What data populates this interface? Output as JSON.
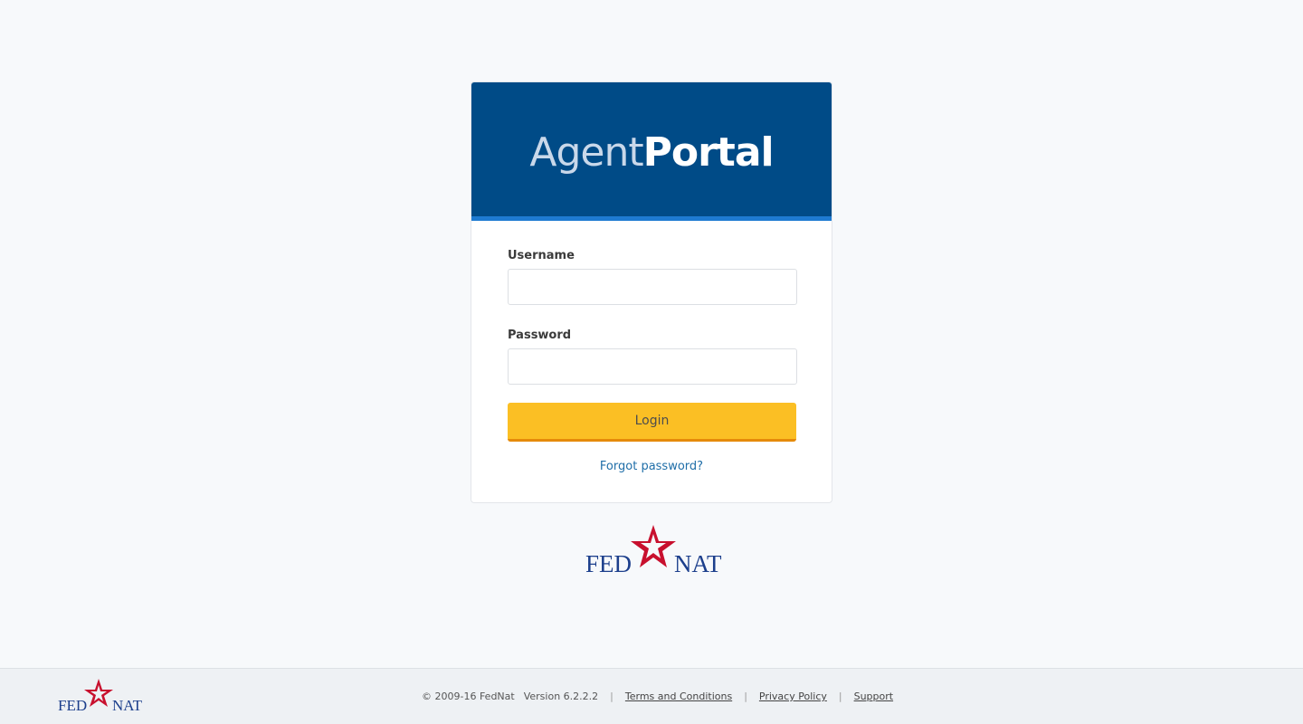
{
  "header": {
    "brand_light": "Agent",
    "brand_bold": "Portal"
  },
  "form": {
    "username_label": "Username",
    "username_value": "",
    "password_label": "Password",
    "password_value": "",
    "login_label": "Login",
    "forgot_label": "Forgot password?"
  },
  "logo": {
    "left_text": "FED",
    "right_text": "NAT",
    "colors": {
      "text": "#1c3f8c",
      "star": "#c8102e"
    }
  },
  "footer": {
    "copyright": "© 2009-16 FedNat",
    "version": "Version 6.2.2.2",
    "links": {
      "terms": "Terms and Conditions",
      "privacy": "Privacy Policy",
      "support": "Support"
    }
  },
  "colors": {
    "header_bg": "#004b87",
    "header_accent": "#1e7ad1",
    "button_bg": "#fbbf24",
    "link": "#1f6ea8"
  }
}
